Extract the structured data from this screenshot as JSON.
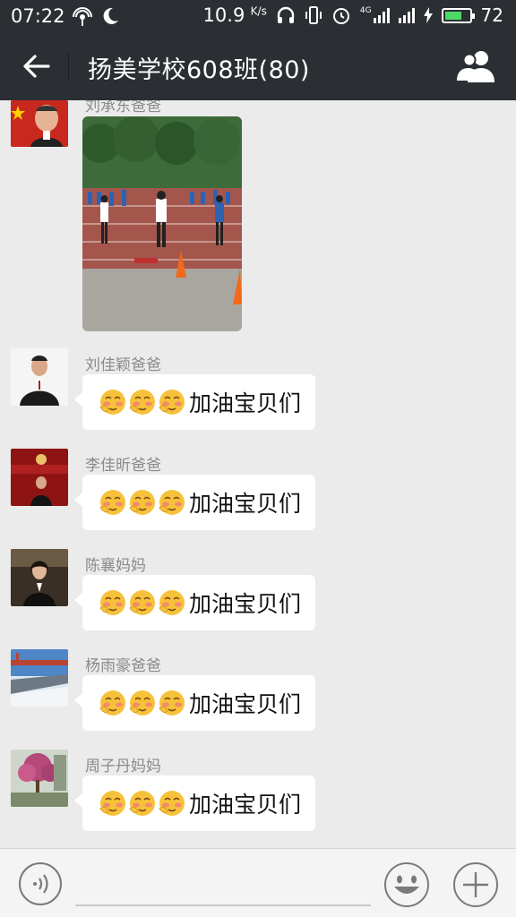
{
  "status_bar": {
    "time": "07:22",
    "speed_value": "10.9",
    "speed_unit": "K/s",
    "network": "4G",
    "battery": "72",
    "battery_level": 0.72
  },
  "header": {
    "title": "扬美学校608班(80)",
    "back_icon": "arrow-left-icon",
    "members_icon": "group-members-icon"
  },
  "messages": [
    {
      "sender": "刘承东爸爸",
      "type": "image"
    },
    {
      "sender": "刘佳颖爸爸",
      "text": "加油宝贝们",
      "emoji_count": 3
    },
    {
      "sender": "李佳昕爸爸",
      "text": "加油宝贝们",
      "emoji_count": 3
    },
    {
      "sender": "陈襄妈妈",
      "text": "加油宝贝们",
      "emoji_count": 3
    },
    {
      "sender": "杨雨豪爸爸",
      "text": "加油宝贝们",
      "emoji_count": 3
    },
    {
      "sender": "周子丹妈妈",
      "text": "加油宝贝们",
      "emoji_count": 3
    }
  ],
  "input_bar": {
    "voice_icon": "voice-input-icon",
    "emoji_icon": "emoji-icon",
    "plus_icon": "plus-icon"
  },
  "colors": {
    "header_bg": "#2b2e33",
    "chat_bg": "#ebebeb",
    "bubble_bg": "#ffffff",
    "battery_green": "#4cd964"
  }
}
